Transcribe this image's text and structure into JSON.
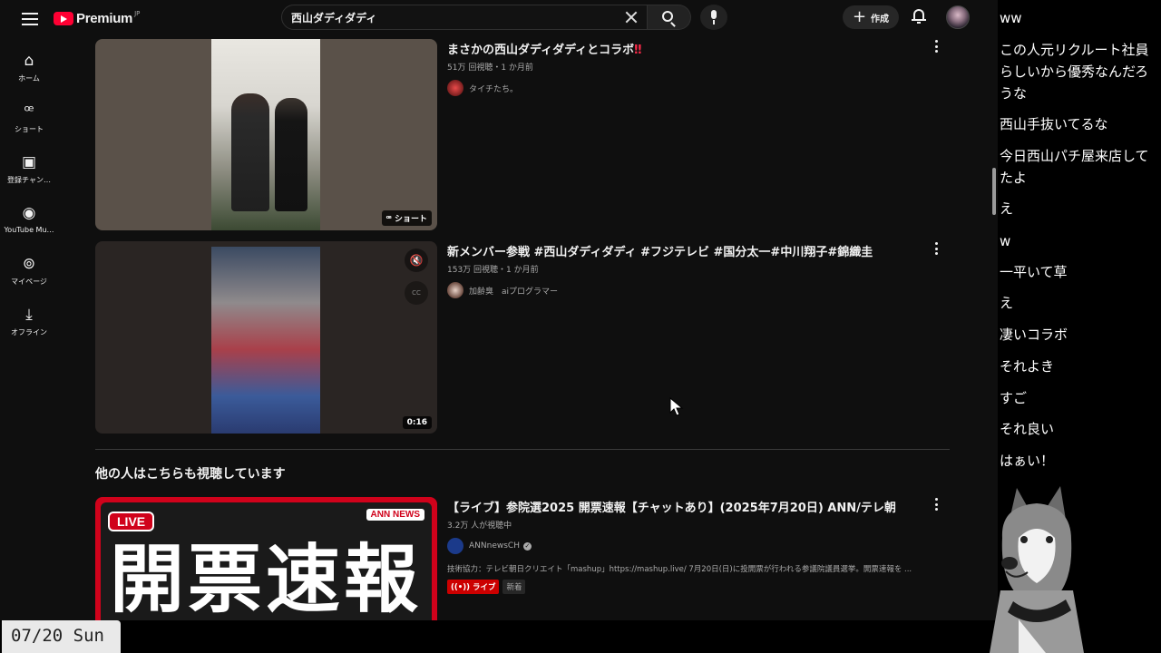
{
  "header": {
    "brand": "Premium",
    "region": "JP",
    "search_query": "西山ダディダディ",
    "create_label": "作成"
  },
  "sidebar": {
    "items": [
      {
        "label": "ホーム",
        "icon": "home-icon"
      },
      {
        "label": "ショート",
        "icon": "shorts-icon"
      },
      {
        "label": "登録チャン…",
        "icon": "subscriptions-icon"
      },
      {
        "label": "YouTube Mu…",
        "icon": "youtube-music-icon"
      },
      {
        "label": "マイページ",
        "icon": "account-icon"
      },
      {
        "label": "オフライン",
        "icon": "download-icon"
      }
    ]
  },
  "videos": [
    {
      "title": "まさかの西山ダディダディとコラボ",
      "title_emoji": "‼",
      "views": "51万 回視聴・1 か月前",
      "channel": "タイチたち。",
      "badge": "ショート"
    },
    {
      "title": "新メンバー参戦 #西山ダディダディ #フジテレビ #国分太一#中川翔子#錦織圭",
      "views": "153万 回視聴・1 か月前",
      "channel": "加齢臭　aiプログラマー",
      "badge": "0:16"
    }
  ],
  "section_title": "他の人はこちらも視聴しています",
  "live_video": {
    "title": "【ライブ】参院選2025 開票速報【チャットあり】(2025年7月20日) ANN/テレ朝",
    "watching": "3.2万 人が視聴中",
    "channel": "ANNnewsCH",
    "description": "技術協力：テレビ朝日クリエイト「mashup」https://mashup.live/ 7月20日(日)に投開票が行われる参議院議員選挙。開票速報を ...",
    "live_tag": "ライブ",
    "new_tag": "新着",
    "thumb_live": "LIVE",
    "thumb_ann": "ANN NEWS",
    "thumb_big": "開票速報"
  },
  "date_overlay": "07/20 Sun",
  "chat": [
    "ww",
    "この人元リクルート社員らしいから優秀なんだろうな",
    "西山手抜いてるな",
    "今日西山パチ屋来店してたよ",
    "え",
    "w",
    "一平いて草",
    "え",
    "凄いコラボ",
    "それよき",
    "すご",
    "それ良い",
    "はぁい！"
  ],
  "colors": {
    "background": "#0f0f0f",
    "brand_red": "#ff0033",
    "live_red": "#cc0000"
  }
}
